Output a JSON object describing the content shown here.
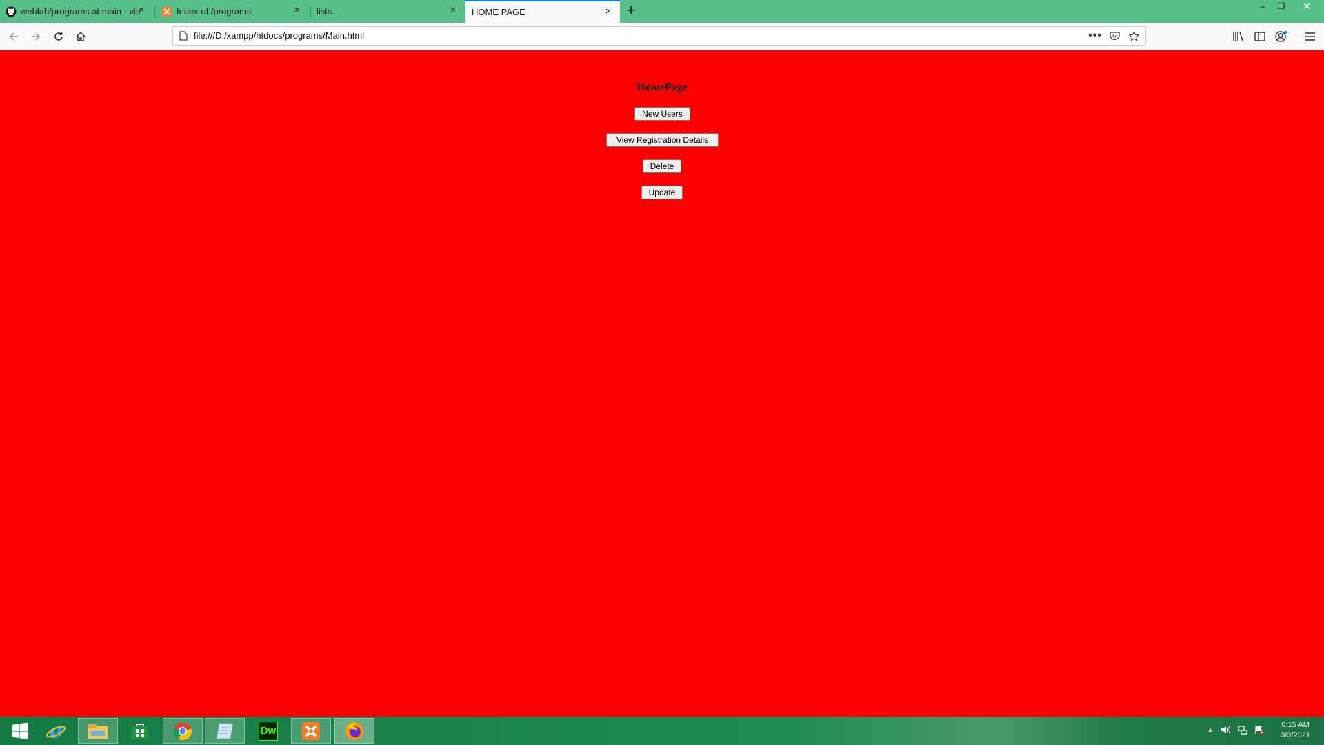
{
  "browser": {
    "tabs": [
      {
        "title": "weblab/programs at main · vis",
        "icon": "github-icon"
      },
      {
        "title": "Index of /programs",
        "icon": "xampp-icon"
      },
      {
        "title": "lists",
        "icon": ""
      },
      {
        "title": "HOME PAGE",
        "icon": "",
        "active": true
      }
    ],
    "url": "file:///D:/xampp/htdocs/programs/Main.html",
    "accent_color": "#57bf8a"
  },
  "page": {
    "background": "#ff0000",
    "heading": "HomePage",
    "buttons": {
      "new_users": "New Users",
      "view_registration": "View Registration Details",
      "delete": "Delete",
      "update": "Update"
    }
  },
  "taskbar": {
    "apps": [
      "start-icon",
      "internet-explorer-icon",
      "file-explorer-icon",
      "store-icon",
      "chrome-icon",
      "app-icon",
      "dreamweaver-icon",
      "xampp-icon",
      "firefox-icon"
    ],
    "dreamweaver_label": "Dw",
    "time": "6:15 AM",
    "date": "3/3/2021"
  }
}
